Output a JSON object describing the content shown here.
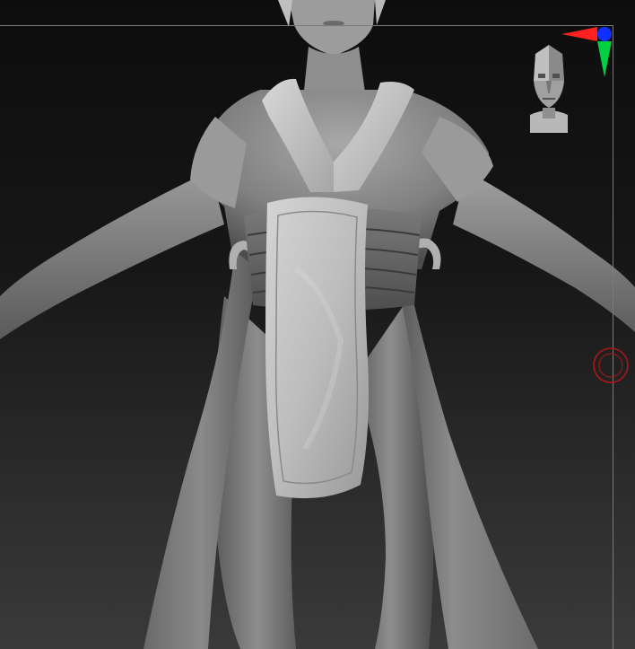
{
  "viewport": {
    "background_top": "#0d0d0d",
    "background_bottom": "#3a3a3a",
    "guide_color": "#7a7a7a"
  },
  "model": {
    "base_color": "#8c8c8c",
    "highlight_color": "#c4c4c4",
    "shadow_color": "#3e3e3e"
  },
  "gizmo": {
    "x_axis_color": "#ff2020",
    "y_axis_color": "#00d040",
    "z_axis_color": "#1030ff"
  },
  "focal_point": {
    "ring_color": "#b01818"
  },
  "icons": {
    "axis": "axis-gizmo-icon",
    "head": "navigation-head-icon",
    "focal": "focal-point-icon"
  }
}
